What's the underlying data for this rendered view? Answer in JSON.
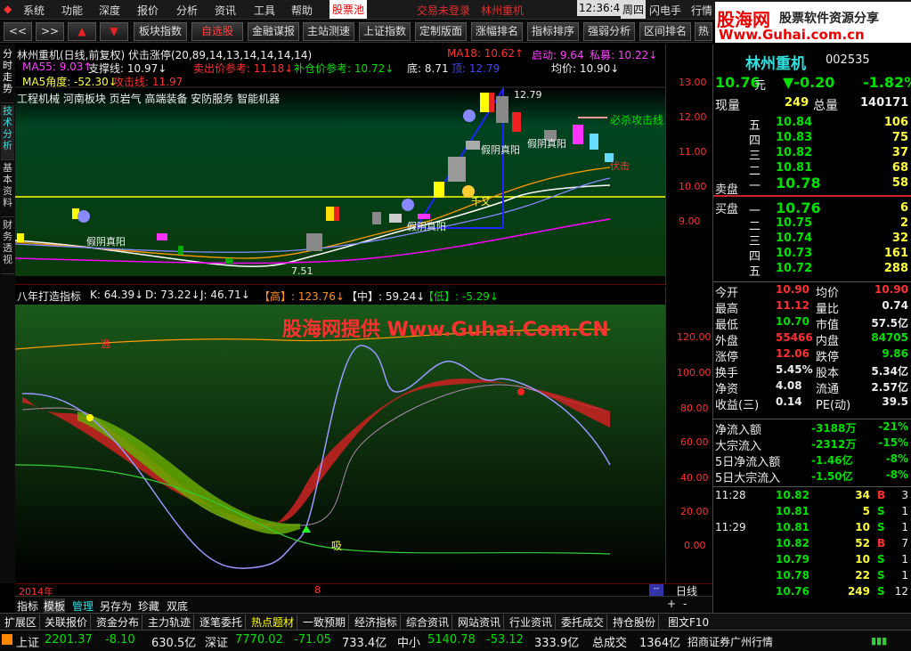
{
  "menu": [
    "系统",
    "功能",
    "深度",
    "报价",
    "分析",
    "资讯",
    "工具",
    "帮助",
    "股票池"
  ],
  "menu_status": {
    "login": "交易未登录",
    "stock": "林州重机",
    "time": "12:36:48",
    "weekday": "周四",
    "flash": "闪电手",
    "quote": "行情"
  },
  "watermark": {
    "cn": "股海网",
    "sub": "股票软件资源分享",
    "url": "Www.Guhai.com.cn"
  },
  "toolbar": [
    "板块指数",
    "自选股",
    "金融谋报",
    "主站测速",
    "上证指数",
    "定制版面",
    "涨幅排名",
    "指标排序",
    "强弱分析",
    "区间排名",
    "热"
  ],
  "lefttabs": [
    "分时走势",
    "技术分析",
    "基本资料",
    "财务透视"
  ],
  "top_chart": {
    "title": "林州重机(日线,前复权) 伏击涨停(20,89,14,13,14,14,14,14)",
    "ma18": "MA18: 10.62↑",
    "qidong": "启动: 9.64",
    "simu": "私募: 10.22↓",
    "ma55": "MA55: 9.03↑",
    "support": "支撑线: 10.97↓",
    "sell_ref": "卖出价参考: 11.18↓",
    "buy_ref": "补仓价参考: 10.72↓",
    "di": "底: 8.71",
    "ding": "顶: 12.79",
    "avg": "均价: 10.90↓",
    "ma5angle": "MA5角度: -52.30↓",
    "attack": "攻击线: 11.97",
    "concept": "工程机械 河南板块 页岩气 高端装备 安防服务 智能机器",
    "annotations": [
      "假阴真阳",
      "假阴真阳",
      "假阴真阳",
      "假阴真阳",
      "必杀攻击线",
      "伏击",
      "12.79",
      "7.51",
      "千又"
    ],
    "yticks": [
      "13.00",
      "12.00",
      "11.00",
      "10.00",
      "9.00"
    ]
  },
  "bot_chart": {
    "title": "八年打造指标",
    "k": "K: 64.39↓",
    "d": "D: 73.22↓",
    "j": "J: 46.71↓",
    "high": "【高】: 123.76↓",
    "mid": "【中】: 59.24↓",
    "low": "【低】: -5.29↓",
    "watermark": "股海网提供 Www.Guhai.Com.CN",
    "label_xi": "吸",
    "label_tou": "逃",
    "yticks": [
      "120.00",
      "100.00",
      "80.00",
      "60.00",
      "40.00",
      "20.00",
      "0.00"
    ],
    "xaxis": {
      "year": "2014年",
      "month": "8"
    }
  },
  "tabs": [
    "指标",
    "模板",
    "管理",
    "另存为",
    "珍藏",
    "双底"
  ],
  "period": "日线",
  "stock": {
    "name": "林州重机",
    "code": "002535",
    "price": "10.76",
    "unit": "元",
    "change": "▼-0.20",
    "pct": "-1.82%",
    "now_label": "现量",
    "now_vol": "249",
    "total_label": "总量",
    "total_vol": "140171"
  },
  "asks": [
    {
      "lv": "五",
      "p": "10.84",
      "v": "106"
    },
    {
      "lv": "四",
      "p": "10.83",
      "v": "75"
    },
    {
      "lv": "三",
      "p": "10.82",
      "v": "37"
    },
    {
      "lv": "二",
      "p": "10.81",
      "v": "68"
    },
    {
      "lv": "一",
      "p": "10.78",
      "v": "58"
    }
  ],
  "bids": [
    {
      "lv": "一",
      "p": "10.76",
      "v": "6"
    },
    {
      "lv": "二",
      "p": "10.75",
      "v": "2"
    },
    {
      "lv": "三",
      "p": "10.74",
      "v": "32"
    },
    {
      "lv": "四",
      "p": "10.73",
      "v": "161"
    },
    {
      "lv": "五",
      "p": "10.72",
      "v": "288"
    }
  ],
  "sell_label": "卖盘",
  "buy_label": "买盘",
  "stats": [
    [
      "今开",
      "10.90",
      "均价",
      "10.90"
    ],
    [
      "最高",
      "11.12",
      "量比",
      "0.74"
    ],
    [
      "最低",
      "10.70",
      "市值",
      "57.5亿"
    ],
    [
      "外盘",
      "55466",
      "内盘",
      "84705"
    ],
    [
      "涨停",
      "12.06",
      "跌停",
      "9.86"
    ],
    [
      "换手",
      "5.45%",
      "股本",
      "5.34亿"
    ],
    [
      "净资",
      "4.08",
      "流通",
      "2.57亿"
    ],
    [
      "收益(三)",
      "0.14",
      "PE(动)",
      "39.5"
    ]
  ],
  "flows": [
    [
      "净流入额",
      "-3188万",
      "-21%"
    ],
    [
      "大宗流入",
      "-2312万",
      "-15%"
    ],
    [
      "5日净流入额",
      "-1.46亿",
      "-8%"
    ],
    [
      "5日大宗流入",
      "-1.50亿",
      "-8%"
    ]
  ],
  "ticks": [
    [
      "11:28",
      "10.82",
      "34",
      "B",
      "3"
    ],
    [
      "",
      "10.81",
      "5",
      "S",
      "1"
    ],
    [
      "11:29",
      "10.81",
      "10",
      "S",
      "1"
    ],
    [
      "",
      "10.82",
      "52",
      "B",
      "7"
    ],
    [
      "",
      "10.79",
      "10",
      "S",
      "1"
    ],
    [
      "",
      "10.78",
      "22",
      "S",
      "1"
    ],
    [
      "",
      "10.76",
      "249",
      "S",
      "12"
    ]
  ],
  "right_tabs": [
    "笔",
    "价",
    "细",
    "盘",
    "势",
    "指",
    "值",
    "买"
  ],
  "bottom_tabs": [
    "扩展区",
    "关联报价",
    "资金分布",
    "主力轨迹",
    "逐笔委托",
    "热点题材",
    "一致预期",
    "经济指标",
    "综合资讯",
    "网站资讯",
    "行业资讯",
    "委托成交",
    "持仓股份"
  ],
  "f10": "图文F10",
  "status": {
    "sh_label": "上证",
    "sh_val": "2201.37",
    "sh_chg": "-8.10",
    "sh_amt": "630.5亿",
    "sz_label": "深证",
    "sz_val": "7770.02",
    "sz_chg": "-71.05",
    "sz_amt": "733.4亿",
    "zx_label": "中小",
    "zx_val": "5140.78",
    "zx_chg": "-53.12",
    "zx_amt": "333.9亿",
    "zcj_label": "总成交",
    "zcj_val": "1364亿",
    "broker": "招商证券广州行情"
  }
}
